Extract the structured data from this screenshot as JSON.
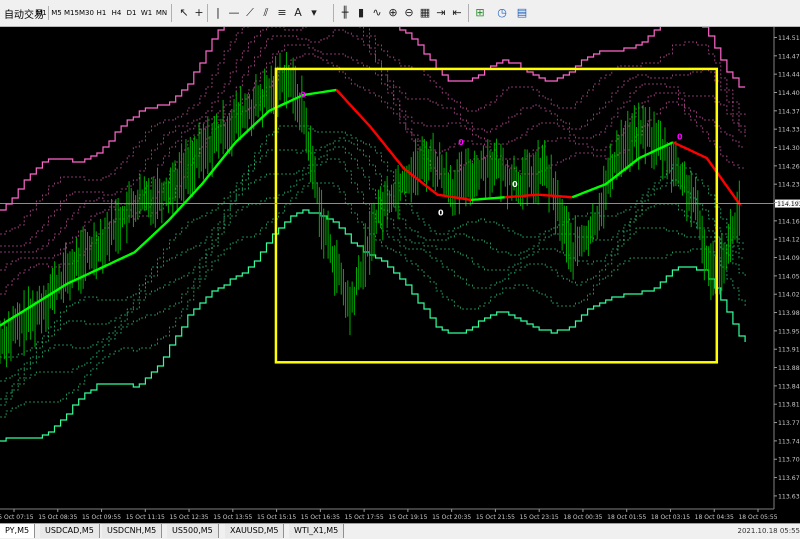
{
  "toolbar": {
    "auto_trading_label": "自动交易",
    "timeframes": [
      "M1",
      "M5",
      "M15",
      "M30",
      "H1",
      "H4",
      "D1",
      "W1",
      "MN"
    ],
    "icons": [
      "cursor-icon",
      "crosshair-icon",
      "vertical-line-icon",
      "horizontal-line-icon",
      "trendline-icon",
      "channel-icon",
      "fibonacci-icon",
      "text-icon",
      "arrow-icon",
      "bar-chart-icon",
      "candlestick-icon",
      "line-chart-icon",
      "zoom-in-icon",
      "zoom-out-icon",
      "tile-windows-icon",
      "autoscroll-icon",
      "chart-shift-icon",
      "indicators-icon",
      "periods-icon",
      "templates-icon"
    ]
  },
  "chart_data": {
    "type": "line",
    "y_ticks": [
      "114.510",
      "114.475",
      "114.440",
      "114.405",
      "114.370",
      "114.335",
      "114.300",
      "114.265",
      "114.230",
      "114.195",
      "114.160",
      "114.125",
      "114.090",
      "114.055",
      "114.020",
      "113.985",
      "113.950",
      "113.915",
      "113.880",
      "113.845",
      "113.810",
      "113.775",
      "113.740",
      "113.705",
      "113.670",
      "113.635"
    ],
    "ylim": [
      113.61,
      114.53
    ],
    "current_price": "114.193",
    "current_price_value": 114.193,
    "x_ticks": [
      "15 Oct 07:15",
      "15 Oct 08:35",
      "15 Oct 09:55",
      "15 Oct 11:15",
      "15 Oct 12:35",
      "15 Oct 13:55",
      "15 Oct 15:15",
      "15 Oct 16:35",
      "15 Oct 17:55",
      "15 Oct 19:15",
      "15 Oct 20:35",
      "15 Oct 21:55",
      "15 Oct 23:15",
      "18 Oct 00:35",
      "18 Oct 01:55",
      "18 Oct 03:15",
      "18 Oct 04:35",
      "18 Oct 05:55"
    ],
    "ma_trend": [
      [
        0,
        113.96
      ],
      [
        1,
        114.0
      ],
      [
        2,
        114.04
      ],
      [
        3,
        114.07
      ],
      [
        4,
        114.1
      ],
      [
        5,
        114.16
      ],
      [
        6,
        114.23
      ],
      [
        7,
        114.31
      ],
      [
        8,
        114.37
      ],
      [
        9,
        114.4
      ],
      [
        10,
        114.41
      ],
      [
        11,
        114.34
      ],
      [
        12,
        114.26
      ],
      [
        13,
        114.21
      ],
      [
        14,
        114.2
      ],
      [
        15,
        114.205
      ],
      [
        16,
        114.21
      ],
      [
        17,
        114.205
      ],
      [
        18,
        114.23
      ],
      [
        19,
        114.28
      ],
      [
        20,
        114.31
      ],
      [
        21,
        114.28
      ],
      [
        22,
        114.19
      ]
    ],
    "up_segments": [
      [
        0,
        10
      ],
      [
        14,
        15
      ],
      [
        17,
        20
      ]
    ],
    "down_segments": [
      [
        10,
        14
      ],
      [
        15,
        17
      ],
      [
        20,
        22
      ]
    ],
    "price_path": [
      [
        0,
        113.93
      ],
      [
        1,
        113.98
      ],
      [
        2,
        114.06
      ],
      [
        3,
        114.12
      ],
      [
        4,
        114.19
      ],
      [
        5,
        114.22
      ],
      [
        6,
        114.29
      ],
      [
        7,
        114.35
      ],
      [
        8,
        114.4
      ],
      [
        8.5,
        114.44
      ],
      [
        9,
        114.37
      ],
      [
        9.6,
        114.15
      ],
      [
        10.4,
        113.99
      ],
      [
        11.2,
        114.17
      ],
      [
        12,
        114.24
      ],
      [
        12.8,
        114.28
      ],
      [
        13.5,
        114.22
      ],
      [
        14.5,
        114.27
      ],
      [
        15.5,
        114.23
      ],
      [
        16.2,
        114.26
      ],
      [
        17,
        114.1
      ],
      [
        17.6,
        114.14
      ],
      [
        18.4,
        114.3
      ],
      [
        19.2,
        114.33
      ],
      [
        19.9,
        114.28
      ],
      [
        20.6,
        114.2
      ],
      [
        21.1,
        114.06
      ],
      [
        21.6,
        114.1
      ],
      [
        22,
        114.19
      ]
    ],
    "envelope_upper_count": 6,
    "envelope_lower_count": 6,
    "signals": [
      {
        "label": "0",
        "x": 9.0,
        "y": 114.395,
        "color": "#ff00ff"
      },
      {
        "label": "0",
        "x": 13.7,
        "y": 114.305,
        "color": "#ff00ff"
      },
      {
        "label": "0",
        "x": 20.2,
        "y": 114.315,
        "color": "#ff00ff"
      },
      {
        "label": "0",
        "x": 15.3,
        "y": 114.225,
        "color": "#ffffff"
      },
      {
        "label": "0",
        "x": 13.1,
        "y": 114.17,
        "color": "#ffffff"
      }
    ],
    "highlight_box": {
      "x0": 8.2,
      "x1": 21.3,
      "y0": 114.45,
      "y1": 113.89,
      "color": "#ffff00"
    },
    "colors": {
      "up": "#00ff00",
      "down": "#ff0000",
      "price": "#00b000",
      "envelope_upper": "#ff66cc",
      "envelope_lower": "#33ff99",
      "grid": "#1a1a1a"
    }
  },
  "tabs": [
    "PY,M5",
    "USDCAD,M5",
    "USDCNH,M5",
    "US500,M5",
    "XAUUSD,M5",
    "WTI_X1,M5"
  ],
  "status_text": "2021.10.18 05:55"
}
